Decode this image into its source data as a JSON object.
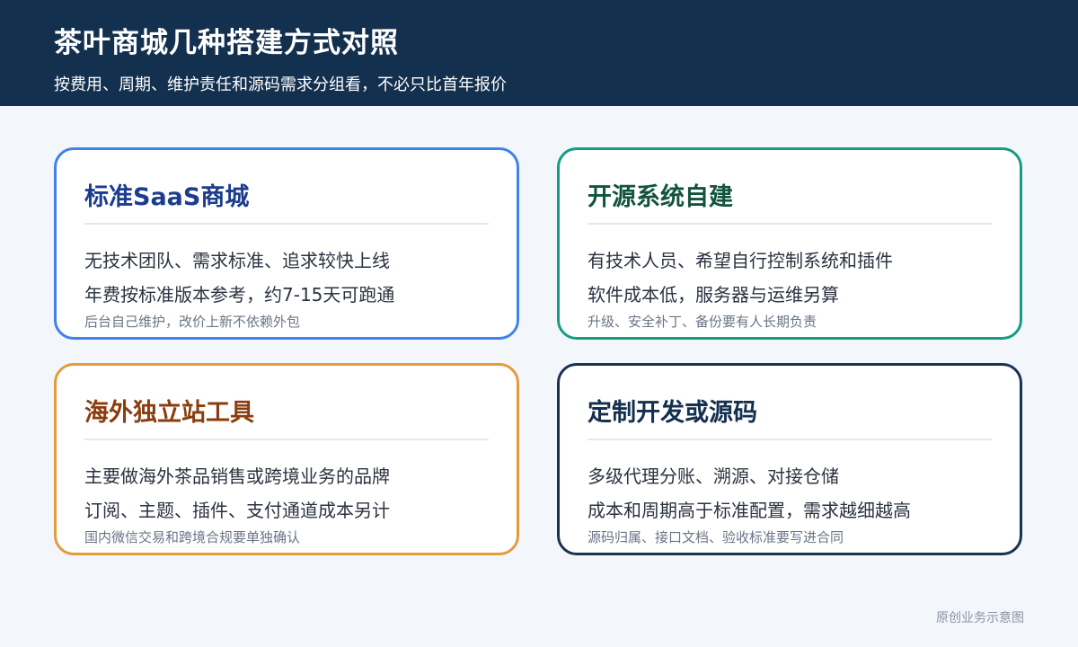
{
  "header": {
    "title": "茶叶商城几种搭建方式对照",
    "subtitle": "按费用、周期、维护责任和源码需求分组看，不必只比首年报价"
  },
  "cards": [
    {
      "title": "标准SaaS商城",
      "line1": "无技术团队、需求标准、追求较快上线",
      "line2": "年费按标准版本参考，约7-15天可跑通",
      "note": "后台自己维护，改价上新不依赖外包"
    },
    {
      "title": "开源系统自建",
      "line1": "有技术人员、希望自行控制系统和插件",
      "line2": "软件成本低，服务器与运维另算",
      "note": "升级、安全补丁、备份要有人长期负责"
    },
    {
      "title": "海外独立站工具",
      "line1": "主要做海外茶品销售或跨境业务的品牌",
      "line2": "订阅、主题、插件、支付通道成本另计",
      "note": "国内微信交易和跨境合规要单独确认"
    },
    {
      "title": "定制开发或源码",
      "line1": "多级代理分账、溯源、对接仓储",
      "line2": "成本和周期高于标准配置，需求越细越高",
      "note": "源码归属、接口文档、验收标准要写进合同"
    }
  ],
  "footer": {
    "text": "原创业务示意图"
  }
}
